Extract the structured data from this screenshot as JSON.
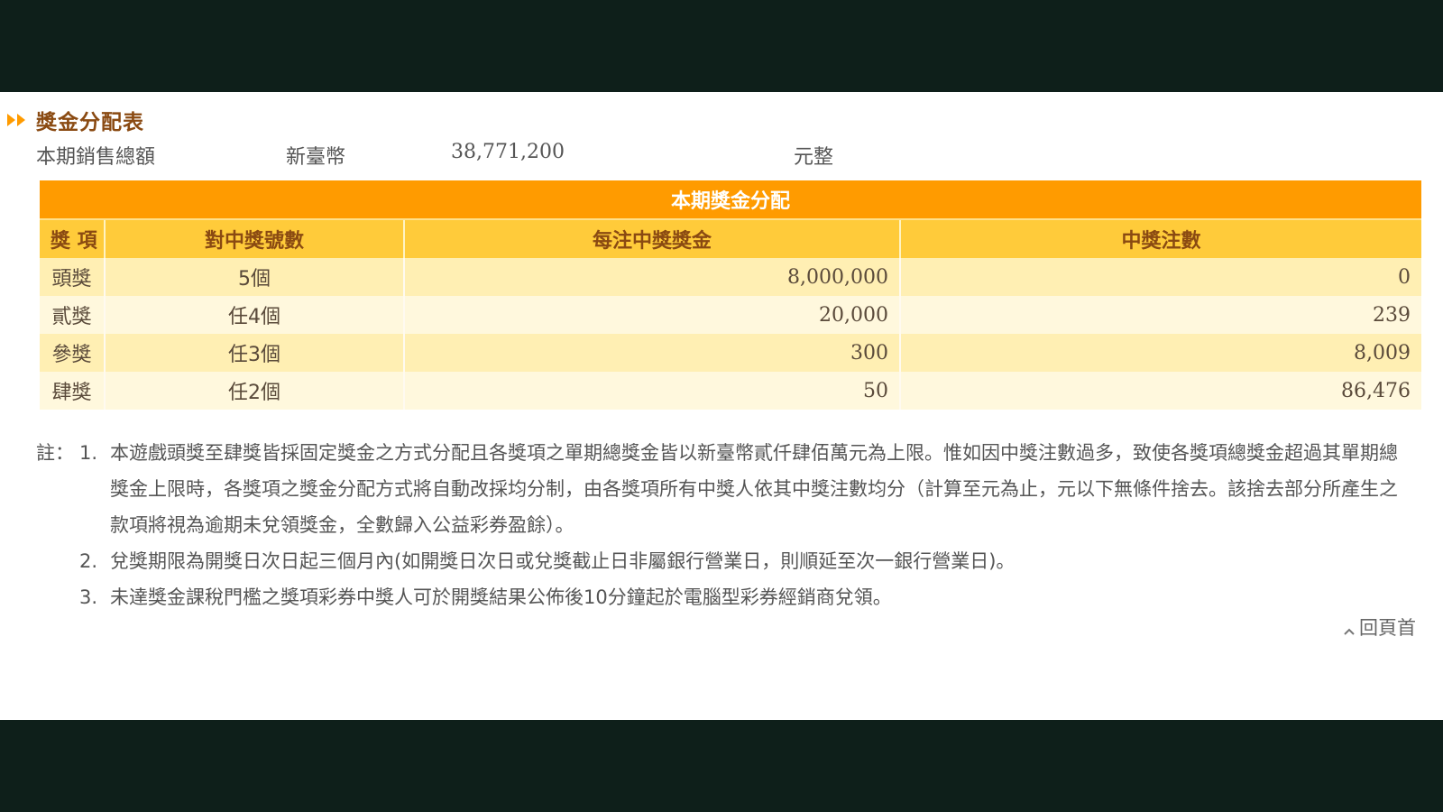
{
  "section": {
    "title": "獎金分配表",
    "icon": "double-chevron-right-icon",
    "accent_color": "#ff9b00"
  },
  "sales": {
    "label": "本期銷售總額",
    "currency": "新臺幣",
    "amount": "38,771,200",
    "unit": "元整"
  },
  "table": {
    "caption": "本期獎金分配",
    "headers": [
      "獎 項",
      "對中獎號數",
      "每注中獎獎金",
      "中獎注數"
    ],
    "rows": [
      {
        "name": "頭獎",
        "match": "5個",
        "amount": "8,000,000",
        "count": "0"
      },
      {
        "name": "貳獎",
        "match": "任4個",
        "amount": "20,000",
        "count": "239"
      },
      {
        "name": "參獎",
        "match": "任3個",
        "amount": "300",
        "count": "8,009"
      },
      {
        "name": "肆獎",
        "match": "任2個",
        "amount": "50",
        "count": "86,476"
      }
    ]
  },
  "notes": {
    "prefix": "註：",
    "items": [
      {
        "num": "1.",
        "text": "本遊戲頭獎至肆獎皆採固定獎金之方式分配且各獎項之單期總獎金皆以新臺幣貳仟肆佰萬元為上限。惟如因中獎注數過多，致使各獎項總獎金超過其單期總獎金上限時，各獎項之獎金分配方式將自動改採均分制，由各獎項所有中獎人依其中獎注數均分（計算至元為止，元以下無條件捨去。該捨去部分所產生之款項將視為逾期未兌領獎金，全數歸入公益彩券盈餘）。"
      },
      {
        "num": "2.",
        "text": "兌獎期限為開獎日次日起三個月內(如開獎日次日或兌獎截止日非屬銀行營業日，則順延至次一銀行營業日)。"
      },
      {
        "num": "3.",
        "text": "未達獎金課稅門檻之獎項彩券中獎人可於開獎結果公佈後10分鐘起於電腦型彩券經銷商兌領。"
      }
    ]
  },
  "back_to_top": {
    "label": "回頁首",
    "icon": "caret-up-icon"
  }
}
